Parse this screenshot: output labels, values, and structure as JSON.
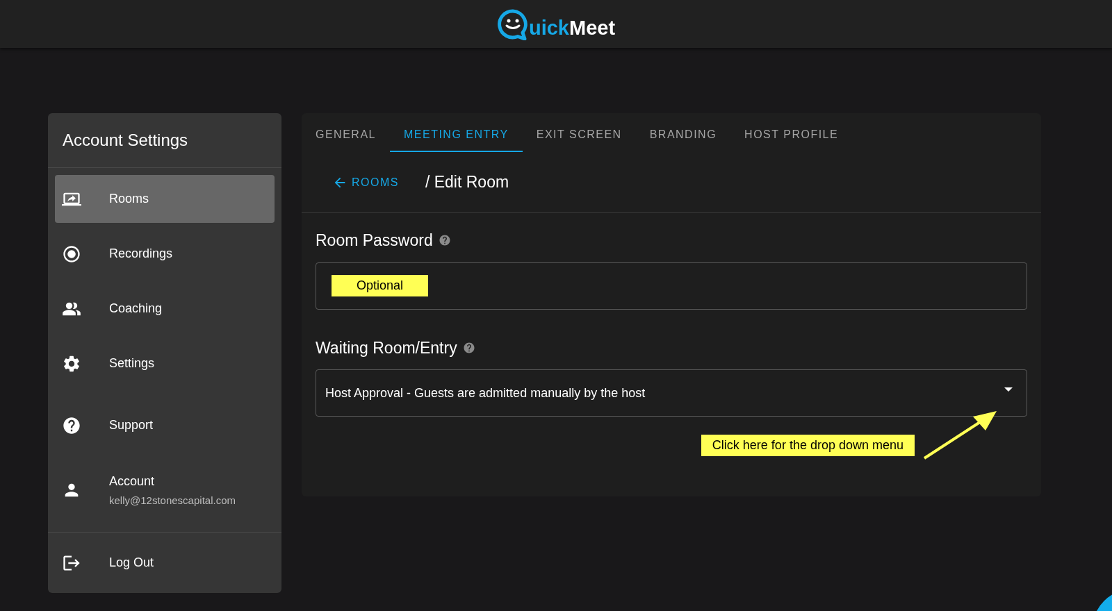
{
  "header": {
    "logo": {
      "part_1": "uick",
      "part_2": "Meet"
    }
  },
  "sidebar": {
    "title": "Account Settings",
    "items": [
      {
        "kind": "rooms",
        "label": "Rooms",
        "selected": true
      },
      {
        "kind": "recordings",
        "label": "Recordings",
        "selected": false
      },
      {
        "kind": "coaching",
        "label": "Coaching",
        "selected": false
      },
      {
        "kind": "settings",
        "label": "Settings",
        "selected": false
      },
      {
        "kind": "support",
        "label": "Support",
        "selected": false
      },
      {
        "kind": "account",
        "label": "Account",
        "subtitle": "kelly@12stonescapital.com",
        "selected": false
      }
    ],
    "logout": {
      "label": "Log Out"
    }
  },
  "tabs": [
    {
      "label": "GENERAL",
      "selected": false
    },
    {
      "label": "MEETING ENTRY",
      "selected": true
    },
    {
      "label": "EXIT SCREEN",
      "selected": false
    },
    {
      "label": "BRANDING",
      "selected": false
    },
    {
      "label": "HOST PROFILE",
      "selected": false
    }
  ],
  "breadcrumb": {
    "back": "ROOMS",
    "current": "/ Edit Room"
  },
  "room_password": {
    "label": "Room Password",
    "annotation": "Optional"
  },
  "waiting_room": {
    "label": "Waiting Room/Entry",
    "value": "Host Approval - Guests are admitted manually by the host"
  },
  "callout": {
    "text": "Click here for the drop down menu"
  }
}
